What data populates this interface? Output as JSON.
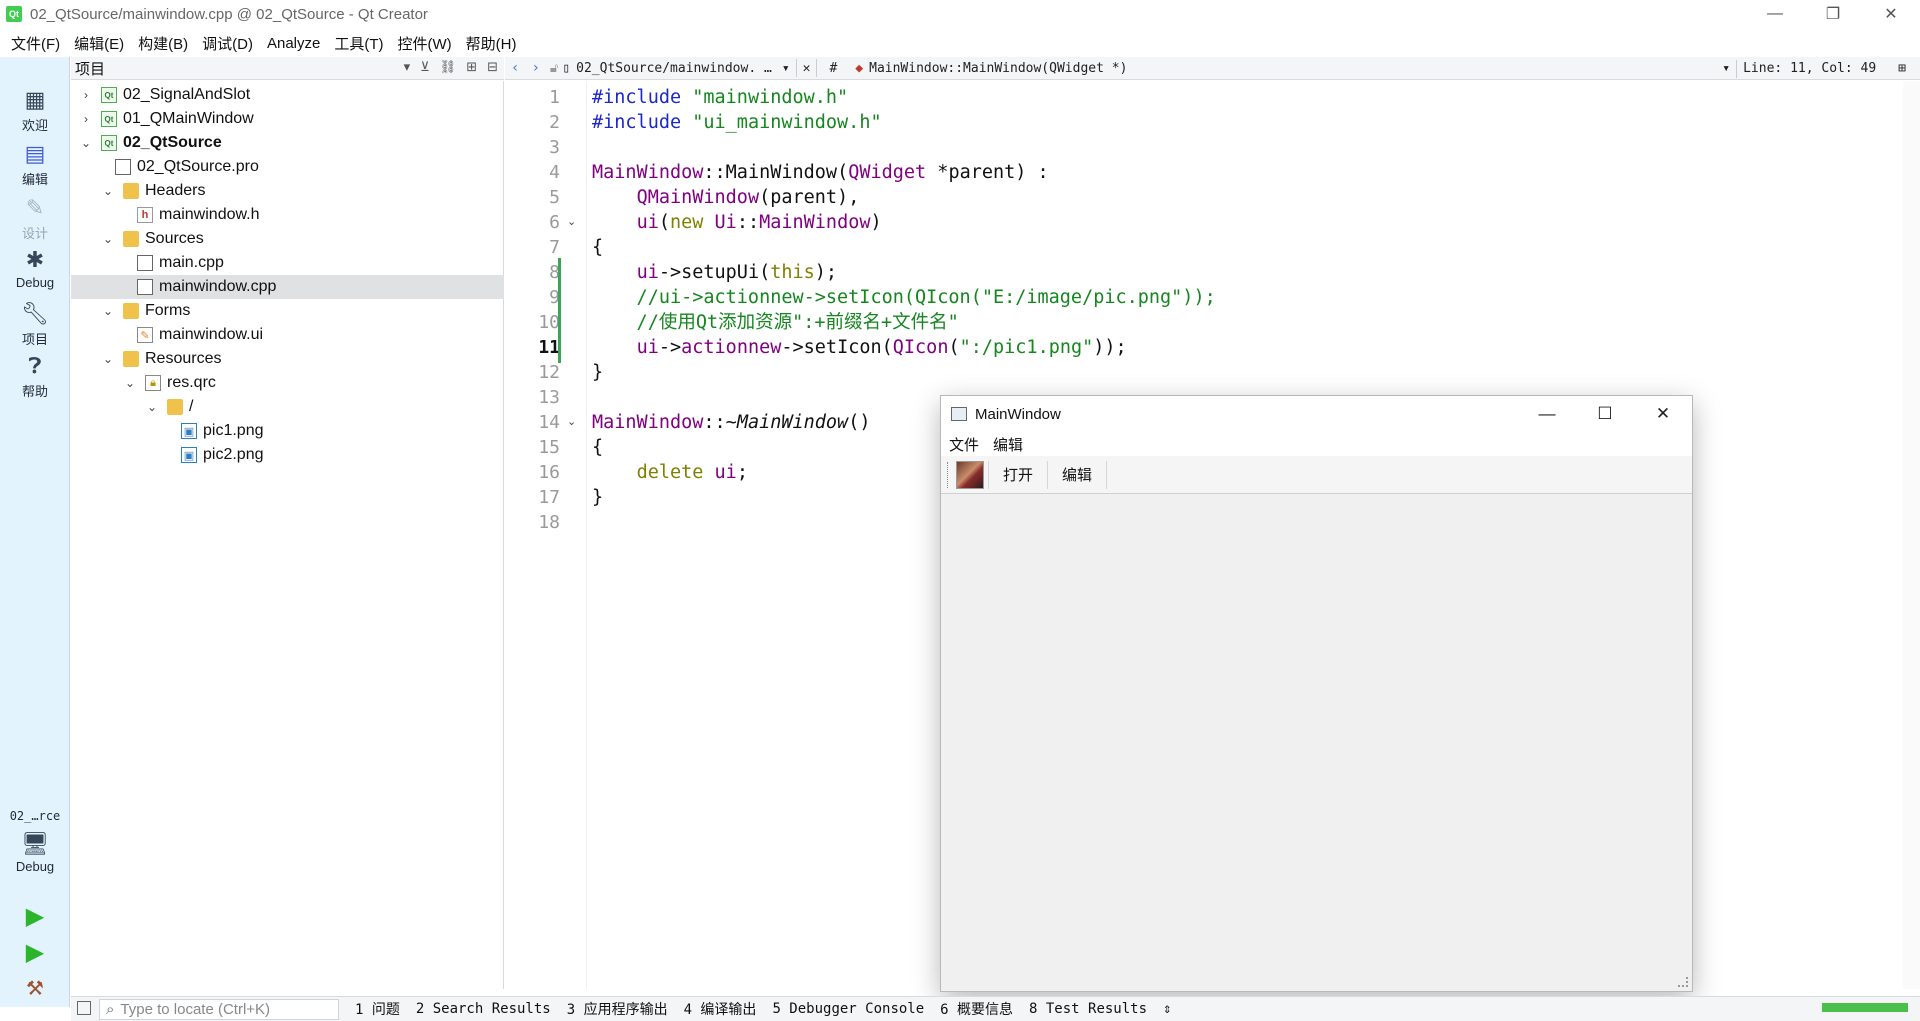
{
  "window": {
    "title": "02_QtSource/mainwindow.cpp @ 02_QtSource - Qt Creator",
    "logo_text": "Qt",
    "minimize": "—",
    "restore": "❐",
    "close": "✕"
  },
  "menu": [
    "文件(F)",
    "编辑(E)",
    "构建(B)",
    "调试(D)",
    "Analyze",
    "工具(T)",
    "控件(W)",
    "帮助(H)"
  ],
  "modes": [
    {
      "label": "欢迎",
      "icon": "grid-icon"
    },
    {
      "label": "编辑",
      "icon": "edit-icon"
    },
    {
      "label": "设计",
      "icon": "pencil-icon"
    },
    {
      "label": "Debug",
      "icon": "bug-icon"
    },
    {
      "label": "项目",
      "icon": "wrench-icon"
    },
    {
      "label": "帮助",
      "icon": "help-icon"
    }
  ],
  "kit": {
    "name": "02_…rce",
    "mode": "Debug"
  },
  "project_panel": {
    "title": "项目",
    "tree": [
      {
        "label": "02_SignalAndSlot",
        "type": "proj",
        "depth": 0,
        "chev": "›"
      },
      {
        "label": "01_QMainWindow",
        "type": "proj",
        "depth": 0,
        "chev": "›"
      },
      {
        "label": "02_QtSource",
        "type": "proj",
        "depth": 0,
        "chev": "⌄",
        "bold": true
      },
      {
        "label": "02_QtSource.pro",
        "type": "file",
        "depth": 1,
        "chev": ""
      },
      {
        "label": "Headers",
        "type": "folder",
        "depth": 1,
        "chev": "⌄"
      },
      {
        "label": "mainwindow.h",
        "type": "hfile",
        "depth": 2,
        "chev": ""
      },
      {
        "label": "Sources",
        "type": "folder",
        "depth": 1,
        "chev": "⌄"
      },
      {
        "label": "main.cpp",
        "type": "file",
        "depth": 2,
        "chev": ""
      },
      {
        "label": "mainwindow.cpp",
        "type": "file",
        "depth": 2,
        "chev": "",
        "selected": true
      },
      {
        "label": "Forms",
        "type": "folder",
        "depth": 1,
        "chev": "⌄"
      },
      {
        "label": "mainwindow.ui",
        "type": "uifile",
        "depth": 2,
        "chev": ""
      },
      {
        "label": "Resources",
        "type": "folder",
        "depth": 1,
        "chev": "⌄"
      },
      {
        "label": "res.qrc",
        "type": "qrc",
        "depth": 2,
        "chev": "⌄"
      },
      {
        "label": "/",
        "type": "folder",
        "depth": 3,
        "chev": "⌄"
      },
      {
        "label": "pic1.png",
        "type": "png",
        "depth": 4,
        "chev": ""
      },
      {
        "label": "pic2.png",
        "type": "png",
        "depth": 4,
        "chev": ""
      }
    ]
  },
  "editor": {
    "file_tab": "02_QtSource/mainwindow. …",
    "symbol": "MainWindow::MainWindow(QWidget *)",
    "hash": "#",
    "position": "Line: 11, Col: 49",
    "current_line": 11,
    "lines": [
      [
        {
          "t": "#include ",
          "c": "c-pp"
        },
        {
          "t": "\"mainwindow.h\"",
          "c": "c-str"
        }
      ],
      [
        {
          "t": "#include ",
          "c": "c-pp"
        },
        {
          "t": "\"ui_mainwindow.h\"",
          "c": "c-str"
        }
      ],
      [],
      [
        {
          "t": "MainWindow",
          "c": "c-cls"
        },
        {
          "t": "::",
          "c": "c-def"
        },
        {
          "t": "MainWindow",
          "c": "c-def"
        },
        {
          "t": "(",
          "c": "c-def"
        },
        {
          "t": "QWidget",
          "c": "c-cls"
        },
        {
          "t": " *parent) :",
          "c": "c-def"
        }
      ],
      [
        {
          "t": "    ",
          "c": "c-def"
        },
        {
          "t": "QMainWindow",
          "c": "c-cls"
        },
        {
          "t": "(parent),",
          "c": "c-def"
        }
      ],
      [
        {
          "t": "    ",
          "c": "c-def"
        },
        {
          "t": "ui",
          "c": "c-cls"
        },
        {
          "t": "(",
          "c": "c-def"
        },
        {
          "t": "new",
          "c": "c-kw"
        },
        {
          "t": " ",
          "c": "c-def"
        },
        {
          "t": "Ui",
          "c": "c-cls"
        },
        {
          "t": "::",
          "c": "c-def"
        },
        {
          "t": "MainWindow",
          "c": "c-cls"
        },
        {
          "t": ")",
          "c": "c-def"
        }
      ],
      [
        {
          "t": "{",
          "c": "c-def"
        }
      ],
      [
        {
          "t": "    ",
          "c": "c-def"
        },
        {
          "t": "ui",
          "c": "c-cls"
        },
        {
          "t": "->setupUi(",
          "c": "c-def"
        },
        {
          "t": "this",
          "c": "c-kw"
        },
        {
          "t": ");",
          "c": "c-def"
        }
      ],
      [
        {
          "t": "    //ui->actionnew->setIcon(QIcon(\"E:/image/pic.png\"));",
          "c": "c-cm"
        }
      ],
      [
        {
          "t": "    //使用Qt添加资源\":+前缀名+文件名\"",
          "c": "c-cm"
        }
      ],
      [
        {
          "t": "    ",
          "c": "c-def"
        },
        {
          "t": "ui",
          "c": "c-cls"
        },
        {
          "t": "->",
          "c": "c-def"
        },
        {
          "t": "actionnew",
          "c": "c-cls"
        },
        {
          "t": "->setIcon(",
          "c": "c-def"
        },
        {
          "t": "QIcon",
          "c": "c-cls"
        },
        {
          "t": "(",
          "c": "c-def"
        },
        {
          "t": "\":/pic1.png\"",
          "c": "c-str"
        },
        {
          "t": "));",
          "c": "c-def"
        }
      ],
      [
        {
          "t": "}",
          "c": "c-def"
        }
      ],
      [],
      [
        {
          "t": "MainWindow",
          "c": "c-cls"
        },
        {
          "t": "::~",
          "c": "c-def"
        },
        {
          "t": "MainWindow",
          "c": "c-def c-it"
        },
        {
          "t": "()",
          "c": "c-def"
        }
      ],
      [
        {
          "t": "{",
          "c": "c-def"
        }
      ],
      [
        {
          "t": "    ",
          "c": "c-def"
        },
        {
          "t": "delete",
          "c": "c-kw"
        },
        {
          "t": " ",
          "c": "c-def"
        },
        {
          "t": "ui",
          "c": "c-cls"
        },
        {
          "t": ";",
          "c": "c-def"
        }
      ],
      [
        {
          "t": "}",
          "c": "c-def"
        }
      ],
      []
    ],
    "fold_lines": [
      6,
      14
    ]
  },
  "app_window": {
    "title": "MainWindow",
    "menu": [
      "文件",
      "编辑"
    ],
    "toolbar": [
      "打开",
      "编辑"
    ]
  },
  "statusbar": {
    "locator_placeholder": "Type to locate (Ctrl+K)",
    "tabs": [
      "1 问题",
      "2 Search Results",
      "3 应用程序输出",
      "4 编译输出",
      "5 Debugger Console",
      "6 概要信息",
      "8 Test Results"
    ],
    "more": "⇕"
  }
}
